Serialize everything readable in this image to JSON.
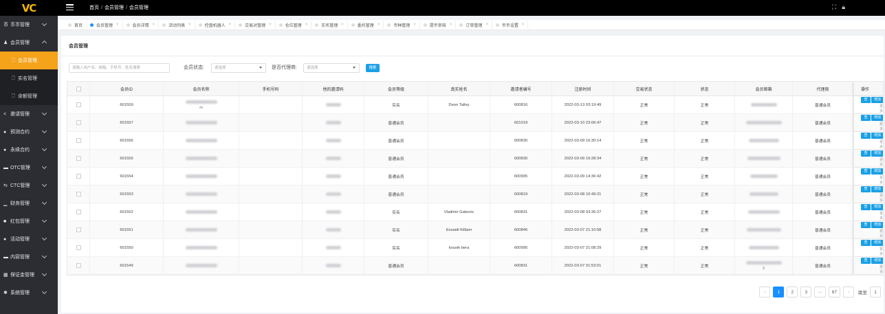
{
  "app": {
    "logo": "VC"
  },
  "topbar": {
    "breadcrumb": [
      "首页",
      "会员管理",
      "会员管理"
    ],
    "icons": [
      "fullscreen-icon",
      "lock-icon"
    ]
  },
  "sidebar": {
    "items": [
      {
        "label": "币币管理",
        "icon": "币"
      },
      {
        "label": "会员管理",
        "icon": "♟",
        "expanded": true
      },
      {
        "label": "会员管理",
        "sub": true,
        "active": true
      },
      {
        "label": "实名管理",
        "sub": true
      },
      {
        "label": "余额管理",
        "sub": true
      },
      {
        "label": "邀请管理",
        "icon": "<"
      },
      {
        "label": "预测合约",
        "icon": "●"
      },
      {
        "label": "永续合约",
        "icon": "●"
      },
      {
        "label": "OTC管理",
        "icon": "▬"
      },
      {
        "label": "CTC管理",
        "icon": "⇆"
      },
      {
        "label": "财务管理",
        "icon": "▁"
      },
      {
        "label": "红包管理",
        "icon": "■"
      },
      {
        "label": "活动管理",
        "icon": "●"
      },
      {
        "label": "内容管理",
        "icon": "▬"
      },
      {
        "label": "保证金管理",
        "icon": "▦"
      },
      {
        "label": "系统管理",
        "icon": "✱"
      }
    ]
  },
  "tabs": [
    "首页",
    "会员管理",
    "会员详情",
    "活动列表",
    "控盘机器人",
    "交易对管理",
    "仓位管理",
    "实名管理",
    "委托管理",
    "币种管理",
    "提币审核",
    "订单管理",
    "币币设置"
  ],
  "page": {
    "title": "会员管理"
  },
  "filters": {
    "search_placeholder": "请输入用户名、邮箱、手机号、姓名搜索",
    "status_label": "会员状态:",
    "status_placeholder": "请选择",
    "agent_label": "是否代理商:",
    "agent_placeholder": "请选择",
    "search_button": "搜索"
  },
  "table": {
    "headers": [
      "会员ID",
      "会员名称",
      "手机号码",
      "他的邀请码",
      "会员等级",
      "真实姓名",
      "邀请者编号",
      "注册时间",
      "交易状态",
      "状态",
      "会员邮箱",
      "代理商",
      "操作"
    ],
    "rows": [
      {
        "id": "601559",
        "name_tail": "m",
        "level": "实名",
        "real_name": "Deon Talley",
        "inviter": "600816",
        "time": "2022-03-13 03:19:49",
        "trade": "正常",
        "status": "正常",
        "email_tail": "",
        "agent": "普通会员"
      },
      {
        "id": "601557",
        "name_tail": "",
        "level": "普通会员",
        "real_name": "",
        "inviter": "601019",
        "time": "2022-03-10 23:06:47",
        "trade": "正常",
        "status": "正常",
        "email_tail": "",
        "agent": "普通会员"
      },
      {
        "id": "601556",
        "name_tail": "",
        "level": "普通会员",
        "real_name": "",
        "inviter": "600830",
        "time": "2022-03-09 16:30:14",
        "trade": "正常",
        "status": "正常",
        "email_tail": "",
        "agent": "普通会员"
      },
      {
        "id": "601555",
        "name_tail": "",
        "level": "普通会员",
        "real_name": "",
        "inviter": "600830",
        "time": "2022-03-09 16:28:34",
        "trade": "正常",
        "status": "正常",
        "email_tail": "",
        "agent": "普通会员"
      },
      {
        "id": "601554",
        "name_tail": "",
        "level": "普通会员",
        "real_name": "",
        "inviter": "600995",
        "time": "2022-03-09 14:36:42",
        "trade": "正常",
        "status": "正常",
        "email_tail": "",
        "agent": "普通会员"
      },
      {
        "id": "601553",
        "name_tail": "",
        "level": "普通会员",
        "real_name": "",
        "inviter": "600819",
        "time": "2022-03-08 10:49:21",
        "trade": "正常",
        "status": "正常",
        "email_tail": "",
        "agent": "普通会员"
      },
      {
        "id": "601552",
        "name_tail": "",
        "level": "实名",
        "real_name": "Vladimir Gabovic",
        "inviter": "600831",
        "time": "2022-03-08 03:36:27",
        "trade": "正常",
        "status": "正常",
        "email_tail": "",
        "agent": "普通会员"
      },
      {
        "id": "601551",
        "name_tail": "",
        "level": "实名",
        "real_name": "Essaidi Killiam",
        "inviter": "600846",
        "time": "2022-03-07 21:10:58",
        "trade": "正常",
        "status": "正常",
        "email_tail": "",
        "agent": "普通会员"
      },
      {
        "id": "601550",
        "name_tail": "",
        "level": "实名",
        "real_name": "kousik bera",
        "inviter": "600995",
        "time": "2022-03-07 21:08:29",
        "trade": "正常",
        "status": "正常",
        "email_tail": "",
        "agent": "普通会员"
      },
      {
        "id": "601549",
        "name_tail": "",
        "level": "普通会员",
        "real_name": "",
        "inviter": "600831",
        "time": "2022-03-07 01:53:01",
        "trade": "正常",
        "status": "正常",
        "email_tail": "2",
        "agent": "普通会员"
      }
    ],
    "row_actions": {
      "view": "查看",
      "add": "增加差",
      "more": "更多"
    }
  },
  "pagination": {
    "pages": [
      "1",
      "2",
      "3",
      "···",
      "67"
    ],
    "current": "1",
    "jump_label": "跳至",
    "jump_value": "1"
  },
  "colors": {
    "accent": "#f5a31a",
    "primary": "#1aa0e6",
    "sidebar": "#2b2d33",
    "topbar": "#000000"
  }
}
